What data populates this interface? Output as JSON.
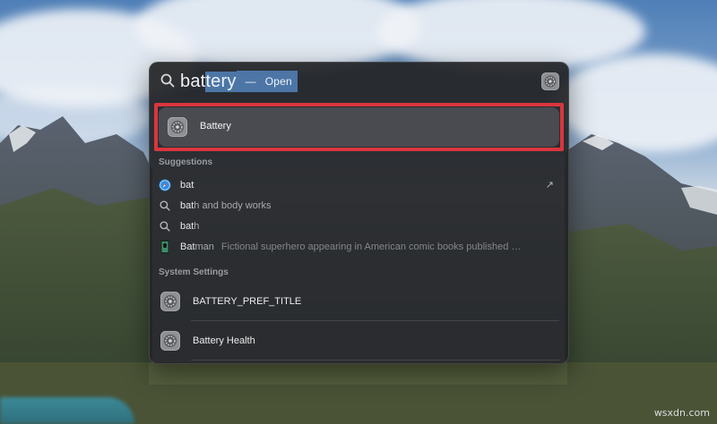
{
  "search": {
    "typed_prefix": "bat",
    "autocomplete": "tery",
    "action_dash": "—",
    "action_label": "Open"
  },
  "top_hit": {
    "label": "Battery",
    "icon": "system-settings-icon"
  },
  "suggestions": {
    "title": "Suggestions",
    "items": [
      {
        "match": "bat",
        "rest": "",
        "icon": "safari-icon"
      },
      {
        "match": "bat",
        "rest": "h and body works",
        "icon": "search-icon"
      },
      {
        "match": "bat",
        "rest": "h",
        "icon": "search-icon"
      },
      {
        "match": "Bat",
        "rest": "man",
        "subtitle": "Fictional superhero appearing in American comic books published by DC Com...",
        "icon": "batman-icon"
      }
    ]
  },
  "system_settings": {
    "title": "System Settings",
    "items": [
      {
        "label": "BATTERY_PREF_TITLE",
        "icon": "system-settings-icon"
      },
      {
        "label": "Battery Health",
        "icon": "system-settings-icon"
      }
    ]
  },
  "watermark": "wsxdn.com",
  "colors": {
    "selection": "#4d76a6",
    "highlight_border": "#d9363e",
    "panel": "#222326"
  }
}
